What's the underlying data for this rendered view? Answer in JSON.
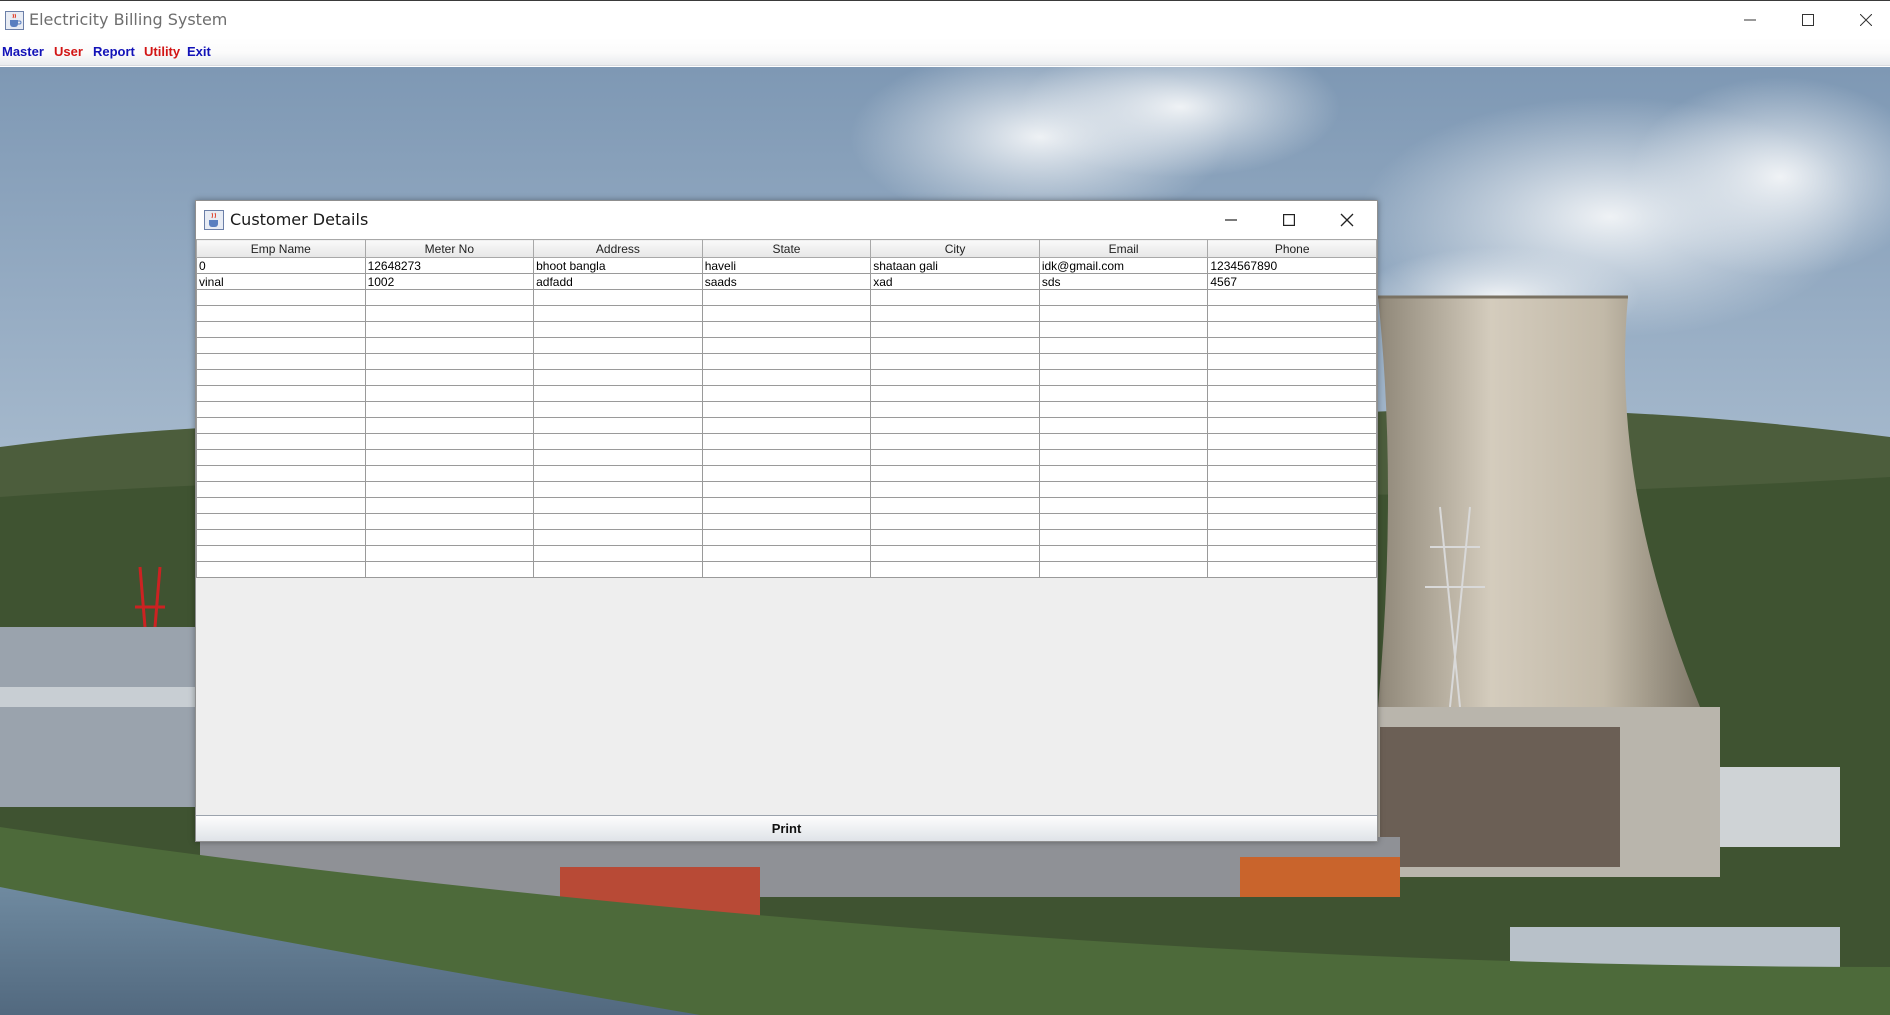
{
  "window": {
    "title": "Electricity Billing System",
    "icons": {
      "app": "java-coffee-icon",
      "minimize": "minimize-icon",
      "maximize": "maximize-icon",
      "close": "close-icon"
    }
  },
  "menu": [
    {
      "label": "Master",
      "color": "#1212b8"
    },
    {
      "label": "User",
      "color": "#d21414"
    },
    {
      "label": "Report",
      "color": "#1212b8"
    },
    {
      "label": "Utility",
      "color": "#d21414"
    },
    {
      "label": "Exit",
      "color": "#1212b8"
    }
  ],
  "dialog": {
    "title": "Customer Details",
    "columns": [
      "Emp Name",
      "Meter No",
      "Address",
      "State",
      "City",
      "Email",
      "Phone"
    ],
    "rows": [
      [
        "0",
        "12648273",
        "bhoot bangla",
        "haveli",
        "shataan gali",
        "idk@gmail.com",
        "1234567890"
      ],
      [
        "vinal",
        "1002",
        "adfadd",
        "saads",
        "xad",
        "sds",
        "4567"
      ]
    ],
    "print_label": "Print"
  },
  "background": {
    "scene": "power-plant-cooling-tower-photo"
  }
}
